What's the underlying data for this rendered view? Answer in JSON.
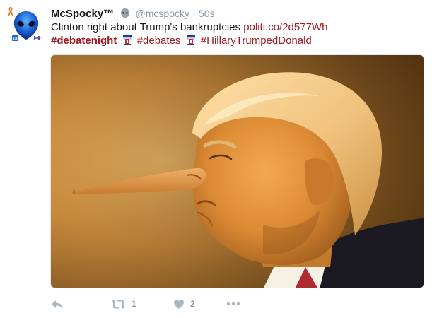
{
  "tweet": {
    "display_name": "McSpocky™",
    "handle": "@mcspocky",
    "separator": "·",
    "time": "50s",
    "text": "Clinton right about Trump's bankruptcies",
    "link": "politi.co/2d577Wh",
    "hashtags": [
      "#debatenight",
      "#debates",
      "#HillaryTrumpedDonald"
    ]
  },
  "actions": {
    "retweet_count": "1",
    "like_count": "2"
  },
  "colors": {
    "link": "#9e1b22",
    "muted": "#8899a6",
    "text": "#14171a"
  },
  "icons": [
    "ribbon-icon",
    "alien-avatar",
    "alien-emoji-icon",
    "podium-icon",
    "reply-icon",
    "retweet-icon",
    "heart-icon",
    "more-icon"
  ]
}
